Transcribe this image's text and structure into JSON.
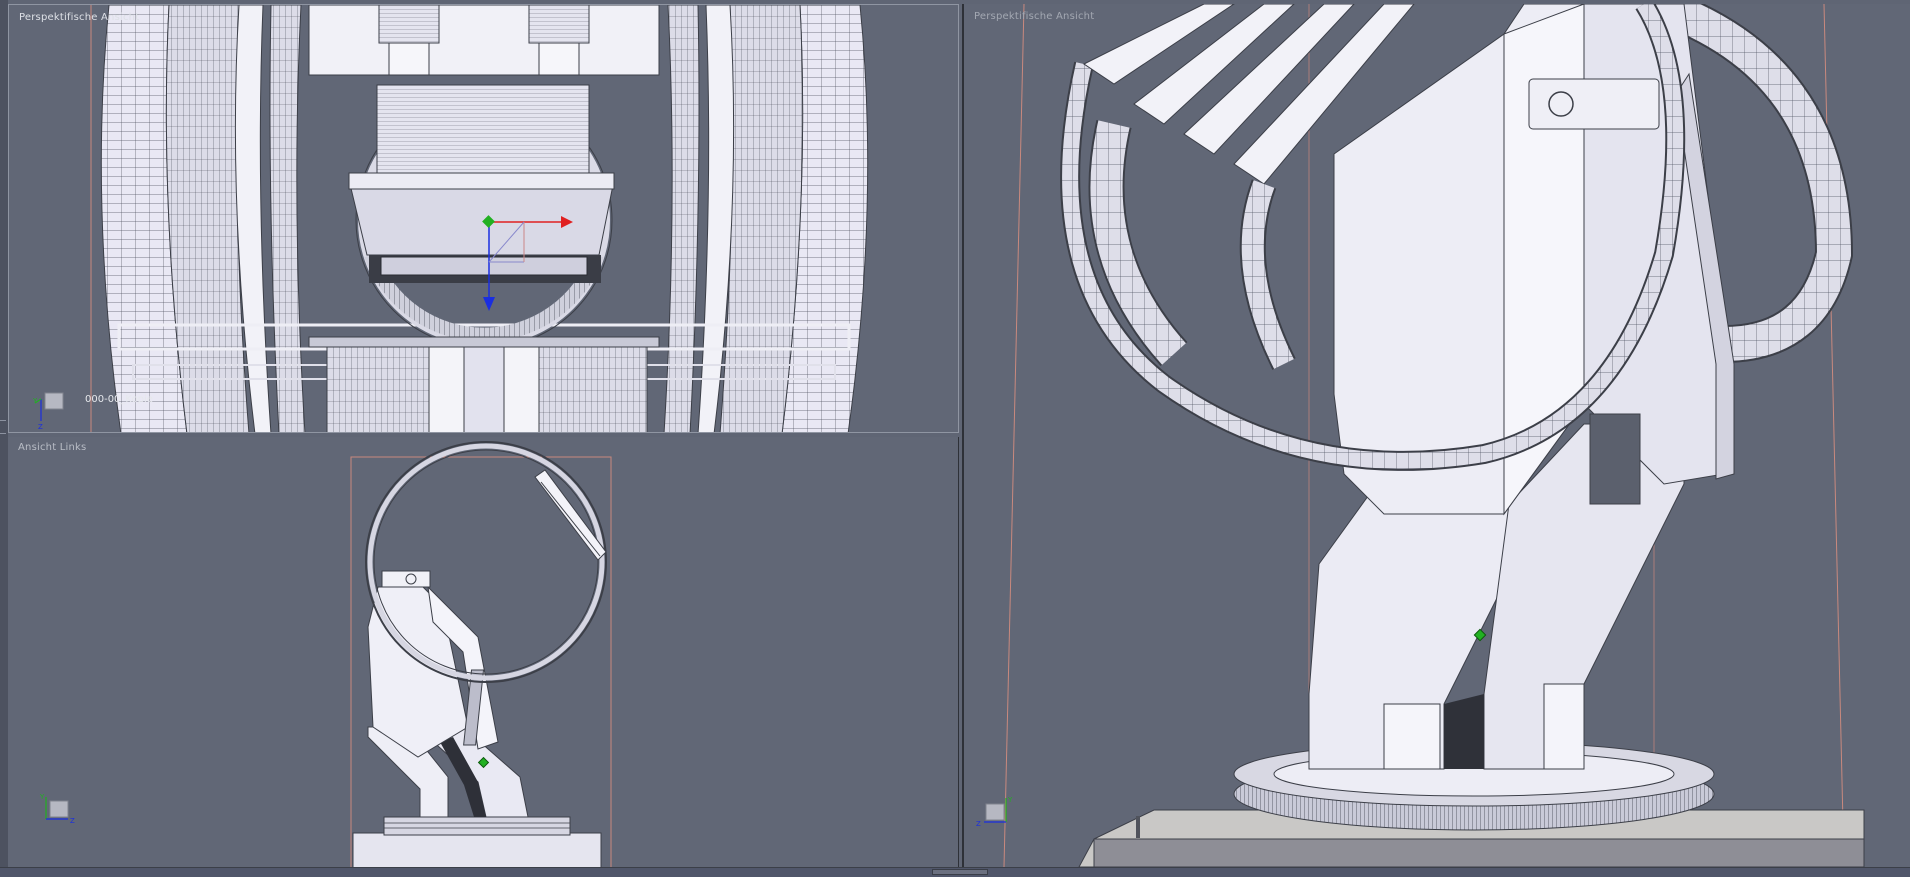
{
  "viewports": {
    "top_left": {
      "label": "Perspektifische Ansicht",
      "object_name": "000-00_Kopie"
    },
    "bottom_left": {
      "label": "Ansicht Links"
    },
    "right": {
      "label": "Perspektifische Ansicht"
    }
  },
  "axes": {
    "top_left": [
      "Y",
      "Z"
    ],
    "bottom_left": [
      "Y",
      "Z"
    ],
    "right": [
      "Y",
      "Z"
    ]
  },
  "colors": {
    "background": "#616776",
    "mesh_fill": "#e6e6f2",
    "mesh_edge": "#3c3f48",
    "bounds": "#c9897e",
    "axis_x": "#e02020",
    "axis_y": "#22b022",
    "axis_z": "#1a2ee0"
  },
  "icons": [
    "transform-gizmo-icon",
    "axis-indicator-icon",
    "pivot-marker-icon"
  ]
}
